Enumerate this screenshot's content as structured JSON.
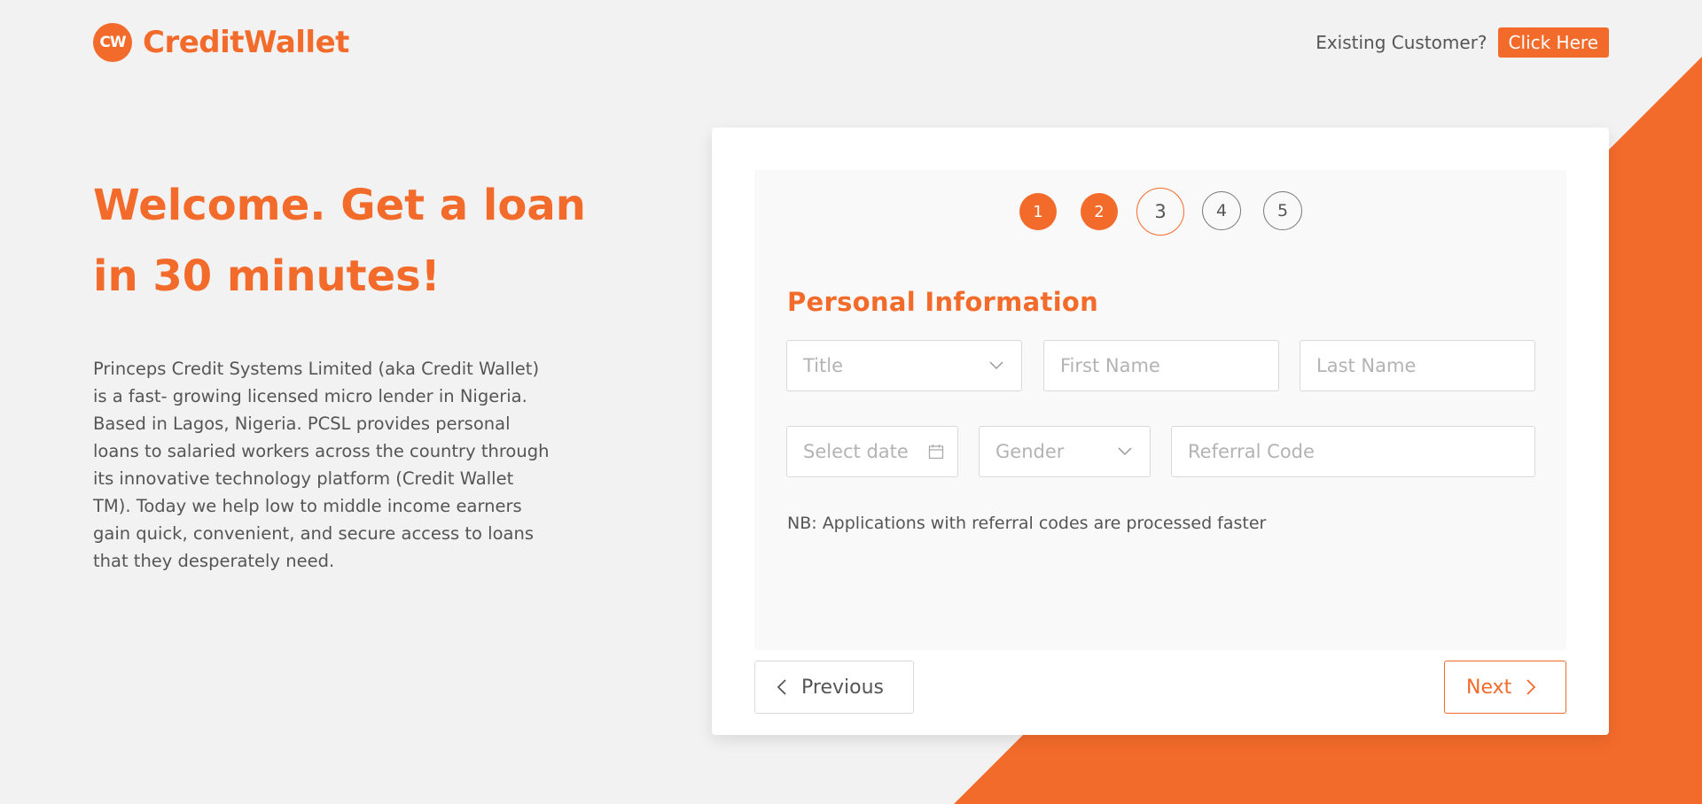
{
  "brand": {
    "name": "CreditWallet",
    "mark": "CW",
    "accent_color": "#f36b2b"
  },
  "header": {
    "existing_label": "Existing Customer?",
    "click_here_label": "Click Here"
  },
  "hero": {
    "title": "Welcome. Get a loan in 30 minutes!",
    "description": "Princeps Credit Systems Limited (aka Credit Wallet) is a fast- growing licensed micro lender in Nigeria. Based in Lagos, Nigeria. PCSL provides personal loans to salaried workers across the country through its innovative technology platform (Credit Wallet TM). Today we help low to middle income earners gain quick, convenient, and secure access to loans that they desperately need."
  },
  "steps": {
    "items": [
      "1",
      "2",
      "3",
      "4",
      "5"
    ],
    "current": 3
  },
  "form": {
    "section_title": "Personal Information",
    "title_placeholder": "Title",
    "first_name_placeholder": "First Name",
    "last_name_placeholder": "Last Name",
    "date_placeholder": "Select date",
    "gender_placeholder": "Gender",
    "referral_placeholder": "Referral Code",
    "note": "NB: Applications with referral codes are processed faster"
  },
  "nav": {
    "previous_label": "Previous",
    "next_label": "Next"
  },
  "icons": {
    "title_select": "chevron-down-icon",
    "gender_select": "chevron-down-icon",
    "date": "calendar-icon",
    "previous": "chevron-left-icon",
    "next": "chevron-right-icon"
  }
}
